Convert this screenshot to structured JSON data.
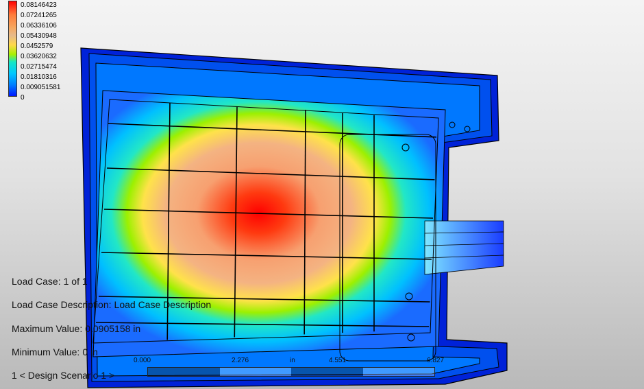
{
  "legend": {
    "values": [
      "0.08146423",
      "0.07241265",
      "0.06336106",
      "0.05430948",
      "0.0452579",
      "0.03620632",
      "0.02715474",
      "0.01810316",
      "0.009051581",
      "0"
    ]
  },
  "info": {
    "load_case_label": "Load Case:",
    "load_case_value": "1 of 1",
    "description_label": "Load Case Description:",
    "description_value": "Load Case Description",
    "max_label": "Maximum Value:",
    "max_value": "0.0905158 in",
    "min_label": "Minimum Value:",
    "min_value": "0 in",
    "scenario": "1 < Design Scenario 1 >"
  },
  "ruler": {
    "labels": [
      "0.000",
      "2.276",
      "in",
      "4.551",
      "6.827"
    ]
  },
  "colors": {
    "max": "#ff0000",
    "min": "#0018ff",
    "body": "#0020e0"
  }
}
